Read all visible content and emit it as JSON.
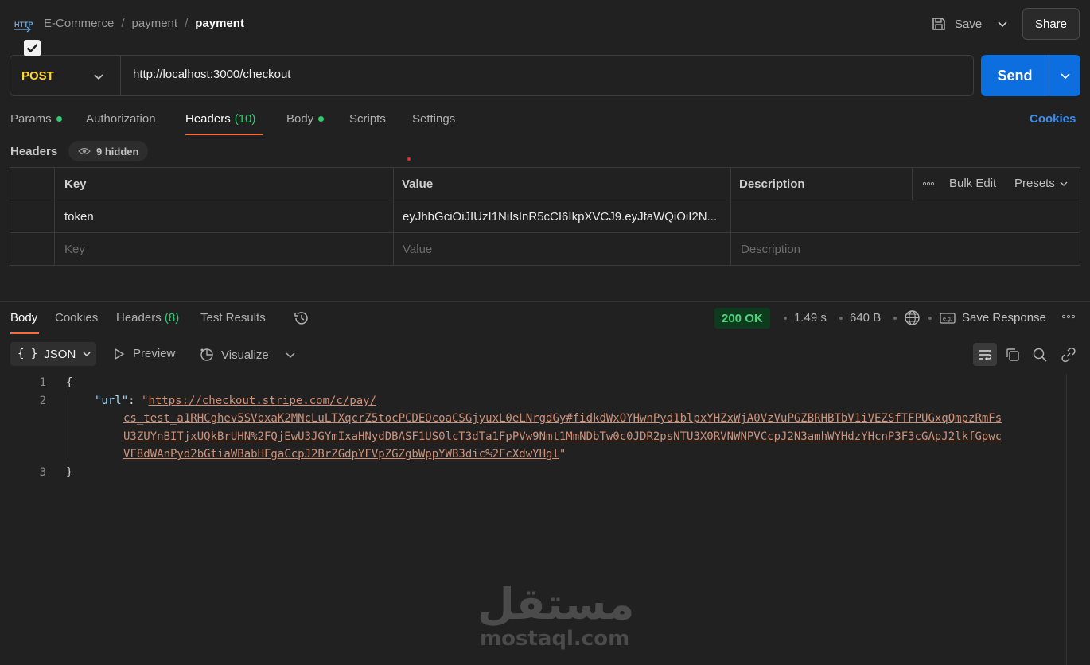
{
  "breadcrumb": {
    "collection": "E-Commerce",
    "folder": "payment",
    "request": "payment",
    "separator": "/"
  },
  "toolbar": {
    "save_label": "Save",
    "share_label": "Share"
  },
  "request": {
    "method": "POST",
    "url": "http://localhost:3000/checkout",
    "send_label": "Send"
  },
  "tabs": {
    "params": "Params",
    "authorization": "Authorization",
    "headers": "Headers",
    "headers_count": "(10)",
    "body": "Body",
    "scripts": "Scripts",
    "settings": "Settings",
    "cookies": "Cookies"
  },
  "headers_section": {
    "label": "Headers",
    "hidden": "9 hidden",
    "columns": {
      "key": "Key",
      "value": "Value",
      "description": "Description"
    },
    "bulk_edit": "Bulk Edit",
    "presets": "Presets",
    "rows": [
      {
        "key": "token",
        "value": "eyJhbGciOiJIUzI1NiIsInR5cCI6IkpXVCJ9.eyJfaWQiOiI2N...",
        "checked": true
      }
    ],
    "placeholders": {
      "key": "Key",
      "value": "Value",
      "description": "Description"
    }
  },
  "response": {
    "tabs": {
      "body": "Body",
      "cookies": "Cookies",
      "headers": "Headers",
      "headers_count": "(8)",
      "test_results": "Test Results"
    },
    "status": "200 OK",
    "time": "1.49 s",
    "size": "640 B",
    "save_response": "Save Response",
    "format": "JSON",
    "preview": "Preview",
    "visualize": "Visualize",
    "code": {
      "open": "{",
      "close": "}",
      "key": "\"url\"",
      "colon": ": ",
      "quote": "\"",
      "url_line1": "https://checkout.stripe.com/c/pay/",
      "url_line2": "cs_test_a1RHCghev5SVbxaK2MNcLuLTXqcrZ5tocPCDEOcoaCSGjyuxL0eLNrgdGy#fidkdWxOYHwnPyd1blpxYHZxWjA0VzVuPGZBRHBTbV1iVEZSfTFPUGxqQmpzRmFs",
      "url_line3": "U3ZUYnBITjxUQkBrUHN%2FQjEwU3JGYmIxaHNydDBASF1US0lcT3dTa1FpPVw9Nmt1MmNDbTw0c0JDR2psNTU3X0RVNWNPVCcpJ2N3amhWYHdzYHcnP3F3cGApJ2lkfGpwc",
      "url_line4": "VF8dWAnPyd2bGtiaWBabHFgaCcpJ2BrZGdpYFVpZGZgbWppYWB3dic%2FcXdwYHgl",
      "line_numbers": [
        "1",
        "2",
        "3"
      ]
    }
  },
  "watermark": {
    "arabic": "مستقل",
    "latin": "mostaql.com"
  },
  "colors": {
    "accent": "#ff6c37",
    "send": "#0d6ee0",
    "method": "#ffd43b",
    "status": "#4cd37c",
    "link": "#3d8cf0"
  }
}
